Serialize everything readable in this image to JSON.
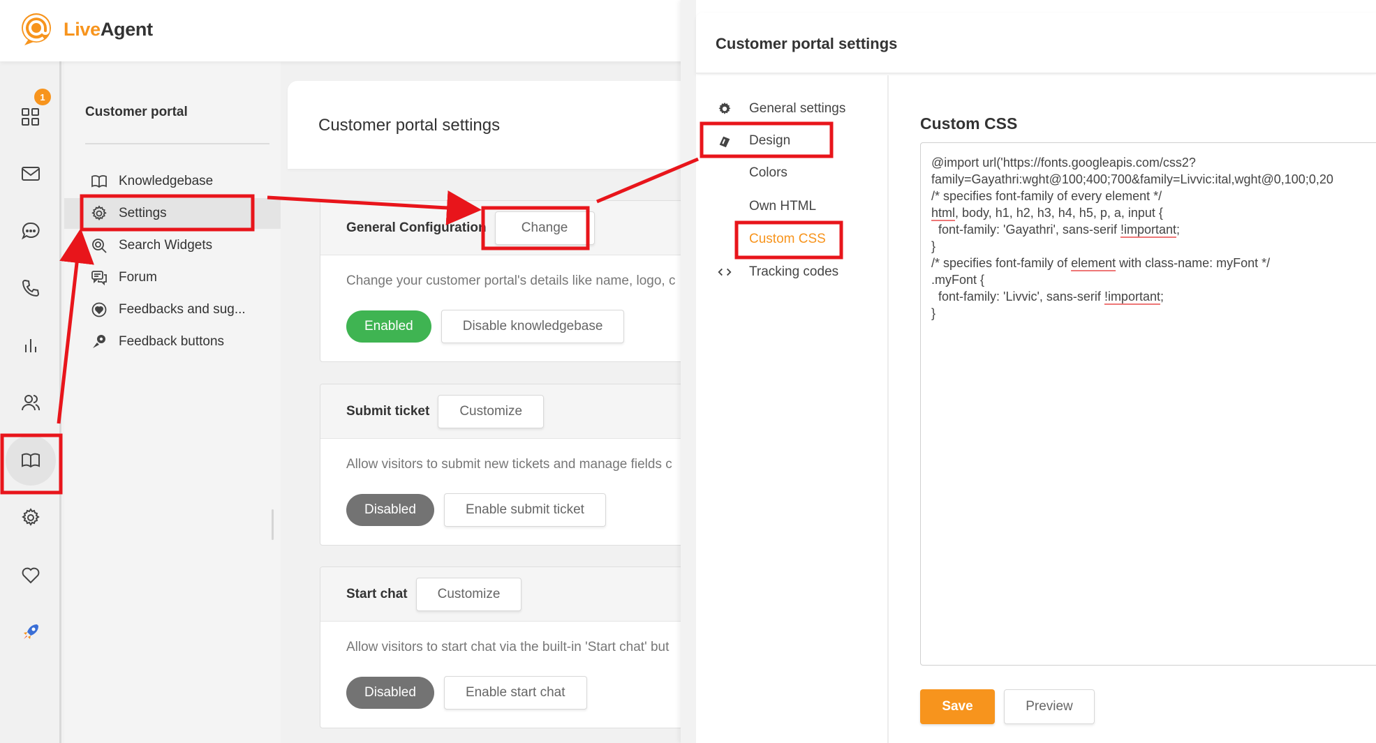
{
  "app": {
    "logo_live": "Live",
    "logo_agent": "Agent"
  },
  "rail": {
    "badge_count": "1"
  },
  "subnav": {
    "title": "Customer portal",
    "items": [
      {
        "label": "Knowledgebase",
        "icon": "book-open-icon"
      },
      {
        "label": "Settings",
        "icon": "gear-icon"
      },
      {
        "label": "Search Widgets",
        "icon": "search-widget-icon"
      },
      {
        "label": "Forum",
        "icon": "forum-icon"
      },
      {
        "label": "Feedbacks and sug...",
        "icon": "feedback-heart-icon"
      },
      {
        "label": "Feedback buttons",
        "icon": "feedback-buttons-icon"
      }
    ]
  },
  "main": {
    "title": "Customer portal settings",
    "cards": [
      {
        "label": "General Configuration",
        "button": "Change",
        "desc": "Change your customer portal's details like name, logo, c",
        "status": "Enabled",
        "action": "Disable knowledgebase"
      },
      {
        "label": "Submit ticket",
        "button": "Customize",
        "desc": "Allow visitors to submit new tickets and manage fields c",
        "status": "Disabled",
        "action": "Enable submit ticket"
      },
      {
        "label": "Start chat",
        "button": "Customize",
        "desc": "Allow visitors to start chat via the built-in 'Start chat' but",
        "status": "Disabled",
        "action": "Enable start chat"
      }
    ]
  },
  "right_panel": {
    "title": "Customer portal settings",
    "nav": [
      {
        "label": "General settings",
        "icon": "gear-icon"
      },
      {
        "label": "Design",
        "icon": "design-icon"
      },
      {
        "label": "Colors"
      },
      {
        "label": "Own HTML"
      },
      {
        "label": "Custom CSS"
      },
      {
        "label": "Tracking codes",
        "icon": "code-icon"
      }
    ],
    "section_title": "Custom CSS",
    "css_lines": [
      "@import url('https://fonts.googleapis.com/css2?",
      "family=Gayathri:wght@100;400;700&family=Livvic:ital,wght@0,100;0,20",
      "",
      "/* specifies font-family of every element */",
      "html, body, h1, h2, h3, h4, h5, p, a, input {",
      "  font-family: 'Gayathri', sans-serif !important;",
      "}",
      "",
      "/* specifies font-family of element with class-name: myFont */",
      ".myFont {",
      "  font-family: 'Livvic', sans-serif !important;",
      "}"
    ],
    "save": "Save",
    "preview": "Preview"
  },
  "colors": {
    "accent": "#f7941d",
    "enabled": "#3fb452",
    "disabled": "#737373",
    "annotation": "#e8151b"
  }
}
